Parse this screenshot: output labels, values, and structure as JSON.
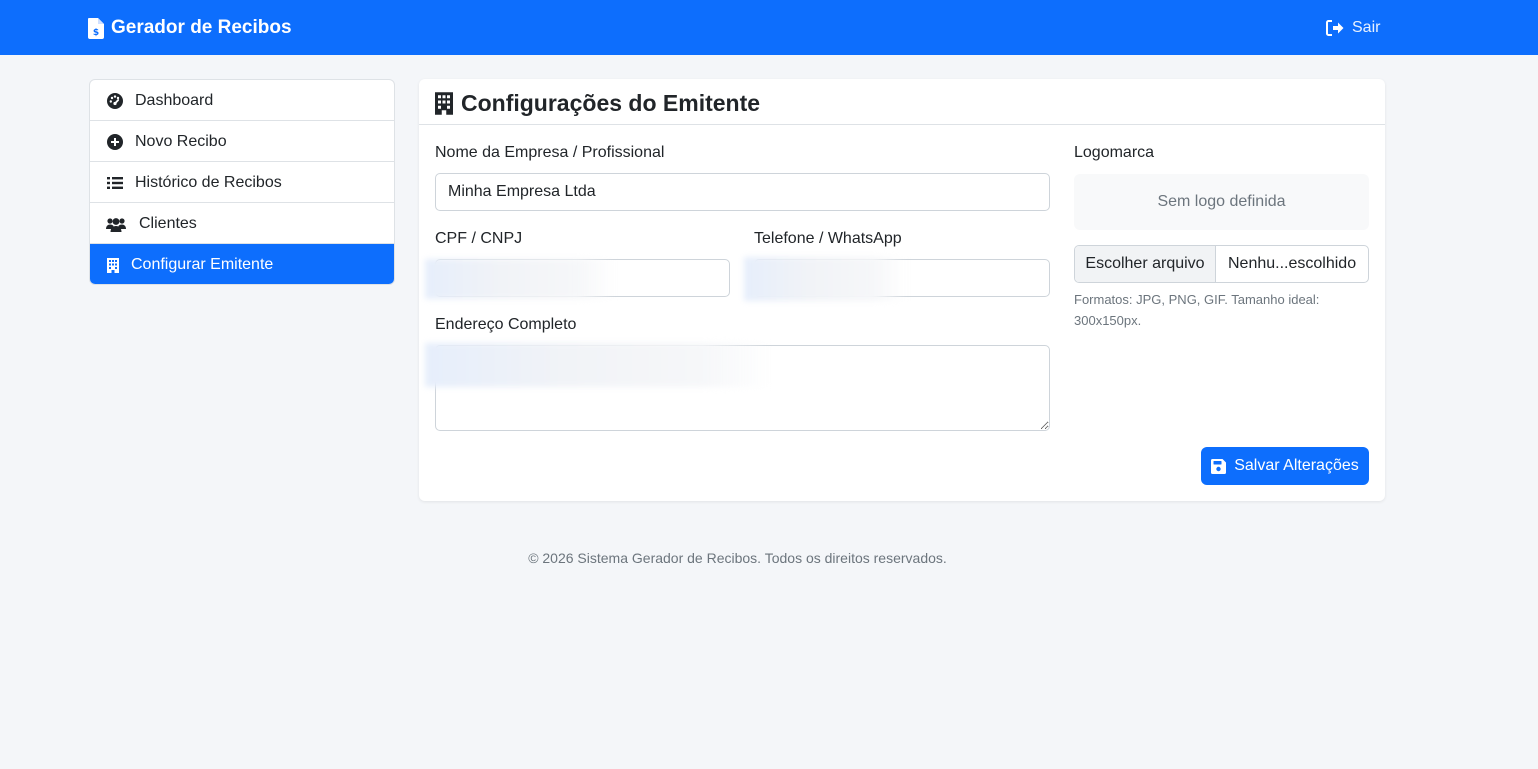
{
  "navbar": {
    "brand_icon": "file-invoice-dollar-icon",
    "brand": "Gerador de Recibos",
    "logout_icon": "sign-out-icon",
    "logout_label": "Sair",
    "color": "#0d6efd"
  },
  "sidebar": {
    "items": [
      {
        "icon": "dashboard-gauge-icon",
        "label": "Dashboard",
        "active": false
      },
      {
        "icon": "plus-circle-icon",
        "label": "Novo Recibo",
        "active": false
      },
      {
        "icon": "list-icon",
        "label": "Histórico de Recibos",
        "active": false
      },
      {
        "icon": "users-icon",
        "label": "Clientes",
        "active": false
      },
      {
        "icon": "building-icon",
        "label": "Configurar Emitente",
        "active": true
      }
    ]
  },
  "card": {
    "title_icon": "building-icon",
    "title": "Configurações do Emitente",
    "company": {
      "label": "Nome da Empresa / Profissional",
      "value": "Minha Empresa Ltda"
    },
    "cpf": {
      "label": "CPF / CNPJ",
      "value": ""
    },
    "phone": {
      "label": "Telefone / WhatsApp",
      "value": ""
    },
    "address": {
      "label": "Endereço Completo",
      "value": ""
    },
    "logo": {
      "label": "Logomarca",
      "placeholder": "Sem logo definida",
      "choose_button": "Escolher arquivo",
      "file_name": "Nenhu...escolhido",
      "help": "Formatos: JPG, PNG, GIF. Tamanho ideal: 300x150px."
    },
    "save_icon": "floppy-disk-icon",
    "save_button": "Salvar Alterações"
  },
  "footer": {
    "text": "© 2026 Sistema Gerador de Recibos. Todos os direitos reservados."
  }
}
